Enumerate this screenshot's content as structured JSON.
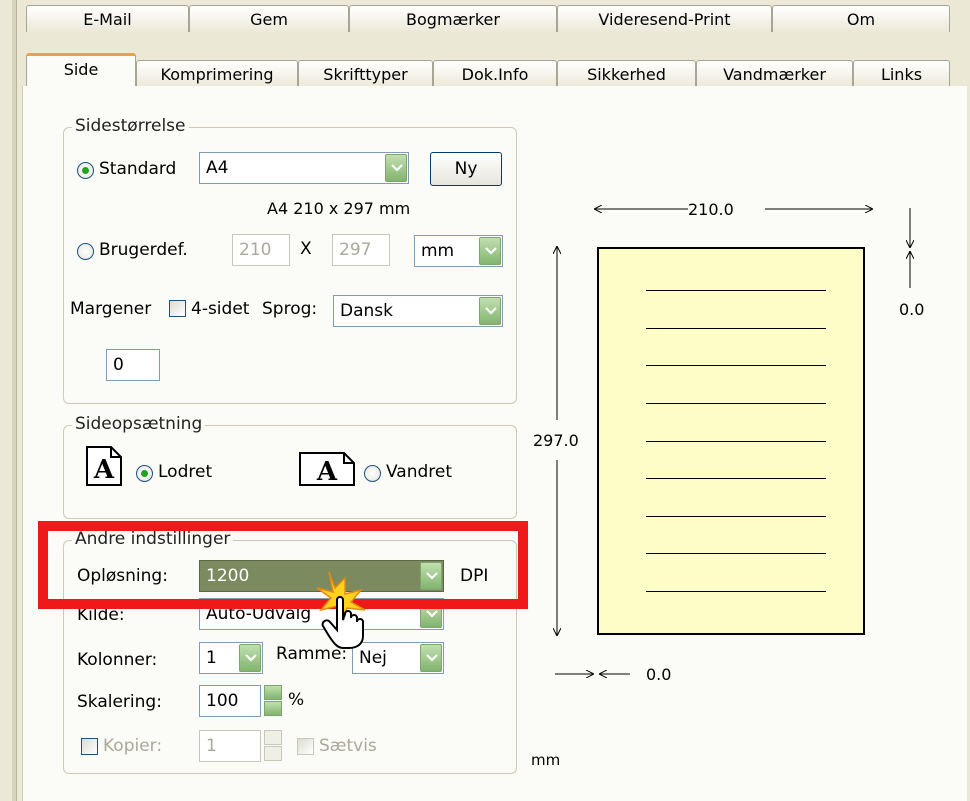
{
  "tabs_row1": [
    "E-Mail",
    "Gem",
    "Bogmærker",
    "Videresend-Print",
    "Om"
  ],
  "tabs_row2": [
    "Side",
    "Komprimering",
    "Skrifttyper",
    "Dok.Info",
    "Sikkerhed",
    "Vandmærker",
    "Links"
  ],
  "active_tab": "Side",
  "sidestorrelse": {
    "legend": "Sidestørrelse",
    "standard_label": "Standard",
    "standard_selected": true,
    "standard_value": "A4",
    "ny_label": "Ny",
    "size_info": "A4 210 x 297 mm",
    "brugerdef_label": "Brugerdef.",
    "width_value": "210",
    "x_label": "X",
    "height_value": "297",
    "unit_value": "mm",
    "margener_label": "Margener",
    "fire_sidet_label": "4-sidet",
    "sprog_label": "Sprog:",
    "sprog_value": "Dansk",
    "margin_value": "0"
  },
  "sideopsaetning": {
    "legend": "Sideopsætning",
    "lodret_label": "Lodret",
    "vandret_label": "Vandret",
    "icon_letter": "A"
  },
  "andre": {
    "legend": "Andre indstillinger",
    "oplosning_label": "Opløsning:",
    "oplosning_value": "1200",
    "dpi_label": "DPI",
    "kilde_label": "Kilde:",
    "kilde_value": "Auto-Udvalg",
    "kolonner_label": "Kolonner:",
    "kolonner_value": "1",
    "ramme_label": "Ramme:",
    "ramme_value": "Nej",
    "skalering_label": "Skalering:",
    "skalering_value": "100",
    "percent_label": "%",
    "kopier_label": "Kopier:",
    "kopier_value": "1",
    "saetvis_label": "Sætvis"
  },
  "preview": {
    "width_label": "210.0",
    "height_label": "297.0",
    "top_margin_label": "0.0",
    "left_margin_label": "0.0",
    "unit_label": "mm"
  },
  "colors": {
    "highlight": "#ef1919",
    "page_fill": "#fffdc7",
    "accent_green": "#82b56e",
    "active_tab_line": "#e8a24a"
  }
}
